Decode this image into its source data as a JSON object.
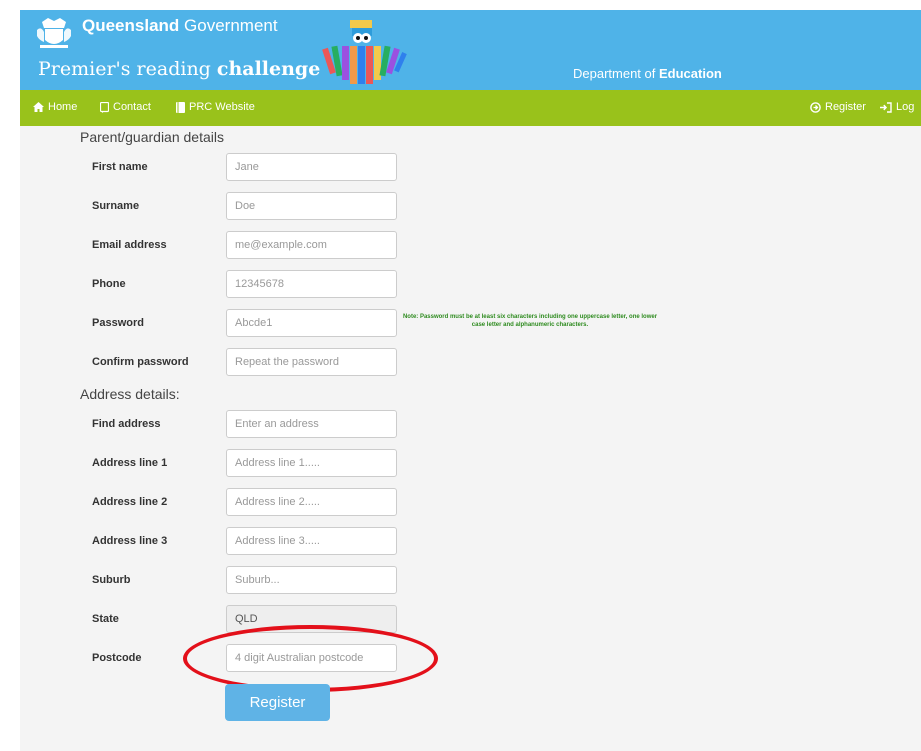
{
  "header": {
    "gov_name_bold": "Queensland",
    "gov_name_rest": " Government",
    "program_prefix": "Premier's reading ",
    "program_bold": "challenge",
    "dept_prefix": "Department of ",
    "dept_bold": "Education"
  },
  "nav": {
    "home": "Home",
    "contact": "Contact",
    "prc_website": "PRC Website",
    "register": "Register",
    "login": "Log"
  },
  "form": {
    "parent_section": "Parent/guardian details",
    "address_section": "Address details:",
    "fields": [
      {
        "label": "First name",
        "placeholder": "Jane"
      },
      {
        "label": "Surname",
        "placeholder": "Doe"
      },
      {
        "label": "Email address",
        "placeholder": "me@example.com"
      },
      {
        "label": "Phone",
        "placeholder": "12345678"
      },
      {
        "label": "Password",
        "placeholder": "Abcde1"
      },
      {
        "label": "Confirm password",
        "placeholder": "Repeat the password"
      },
      {
        "label": "Find address",
        "placeholder": "Enter an address"
      },
      {
        "label": "Address line 1",
        "placeholder": "Address line 1....."
      },
      {
        "label": "Address line 2",
        "placeholder": "Address line 2....."
      },
      {
        "label": "Address line 3",
        "placeholder": "Address line 3....."
      },
      {
        "label": "Suburb",
        "placeholder": "Suburb..."
      },
      {
        "label": "State",
        "value": "QLD"
      },
      {
        "label": "Postcode",
        "placeholder": "4 digit Australian postcode"
      }
    ],
    "password_note": "Note: Password must be at least six characters including one uppercase letter, one lower case letter and alphanumeric characters.",
    "register_button": "Register"
  },
  "colors": {
    "header_blue": "#4fb3e8",
    "nav_green": "#99c21b",
    "note_green": "#2e8b1f",
    "button_blue": "#5fb3e6",
    "annotation_red": "#e3101a"
  }
}
